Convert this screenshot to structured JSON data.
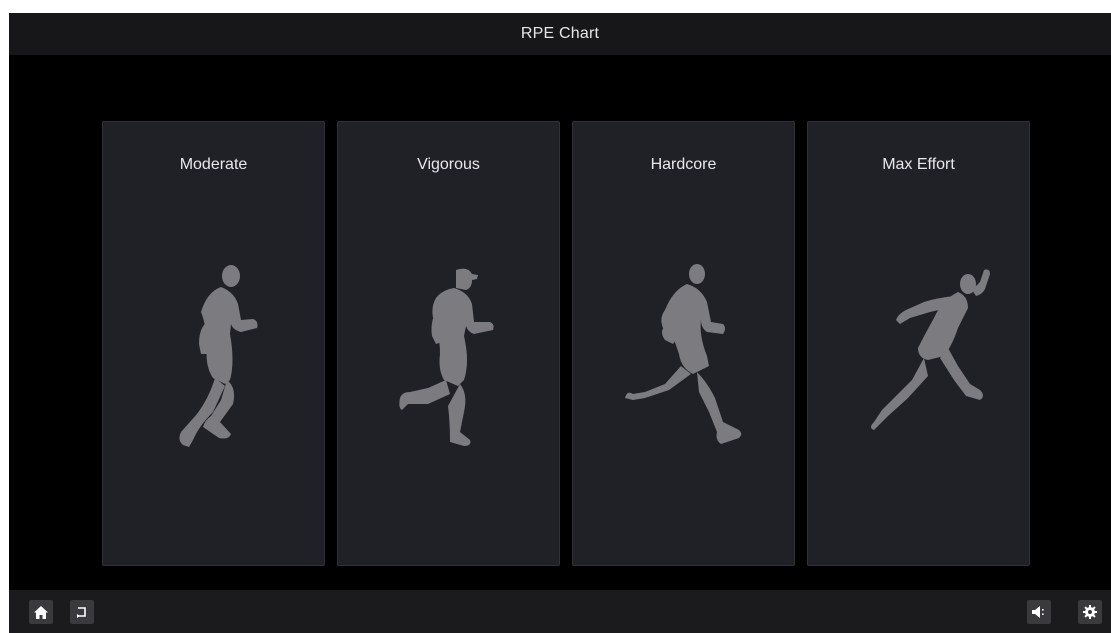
{
  "header": {
    "title": "RPE Chart"
  },
  "cards": [
    {
      "label": "Moderate",
      "figure": "jogging-runner-icon"
    },
    {
      "label": "Vigorous",
      "figure": "running-runner-icon"
    },
    {
      "label": "Hardcore",
      "figure": "fast-runner-icon"
    },
    {
      "label": "Max Effort",
      "figure": "sprinting-runner-icon"
    }
  ],
  "bottom_bar": {
    "left_icons": [
      "home-icon",
      "back-icon"
    ],
    "right_icons": [
      "volume-icon",
      "settings-icon"
    ]
  },
  "colors": {
    "background": "#000000",
    "card": "#202027",
    "bar": "#1b1b1e",
    "figure": "#7b7b80",
    "text": "#e9e9ea"
  }
}
